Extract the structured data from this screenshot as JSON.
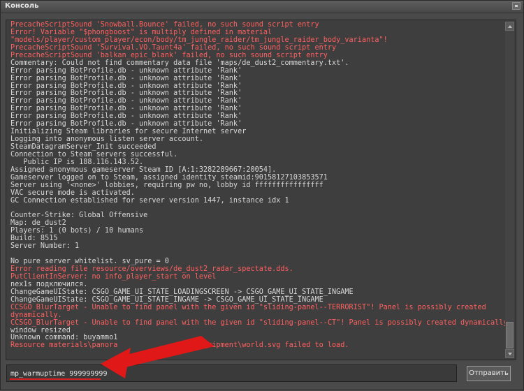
{
  "window": {
    "title": "Консоль"
  },
  "console": {
    "lines": [
      {
        "text": "PrecacheScriptSound 'Snowball.Bounce' failed, no such sound script entry",
        "type": "error"
      },
      {
        "text": "Error! Variable \"$phongboost\" is multiply defined in material",
        "type": "error"
      },
      {
        "text": "\"models/player/custom_player/econ/body/tm_jungle_raider/tm_jungle_raider_body_varianta\"!",
        "type": "error"
      },
      {
        "text": "PrecacheScriptSound 'Survival.VO.Taunt4a' failed, no such sound script entry",
        "type": "error"
      },
      {
        "text": "PrecacheScriptSound 'balkan_epic_blank' failed, no such sound script entry",
        "type": "error"
      },
      {
        "text": "Commentary: Could not find commentary data file 'maps/de_dust2_commentary.txt'.",
        "type": "normal"
      },
      {
        "text": "Error parsing BotProfile.db - unknown attribute 'Rank'",
        "type": "normal"
      },
      {
        "text": "Error parsing BotProfile.db - unknown attribute 'Rank'",
        "type": "normal"
      },
      {
        "text": "Error parsing BotProfile.db - unknown attribute 'Rank'",
        "type": "normal"
      },
      {
        "text": "Error parsing BotProfile.db - unknown attribute 'Rank'",
        "type": "normal"
      },
      {
        "text": "Error parsing BotProfile.db - unknown attribute 'Rank'",
        "type": "normal"
      },
      {
        "text": "Error parsing BotProfile.db - unknown attribute 'Rank'",
        "type": "normal"
      },
      {
        "text": "Error parsing BotProfile.db - unknown attribute 'Rank'",
        "type": "normal"
      },
      {
        "text": "Error parsing BotProfile.db - unknown attribute 'Rank'",
        "type": "normal"
      },
      {
        "text": "Initializing Steam libraries for secure Internet server",
        "type": "normal"
      },
      {
        "text": "Logging into anonymous listen server account.",
        "type": "normal"
      },
      {
        "text": "SteamDatagramServer_Init succeeded",
        "type": "normal"
      },
      {
        "text": "Connection to Steam servers successful.",
        "type": "normal"
      },
      {
        "text": "   Public IP is 188.116.143.52.",
        "type": "normal"
      },
      {
        "text": "Assigned anonymous gameserver Steam ID [A:1:3282289667:20054].",
        "type": "normal"
      },
      {
        "text": "Gameserver logged on to Steam, assigned identity steamid:90158127103853571",
        "type": "normal"
      },
      {
        "text": "Server using '<none>' lobbies, requiring pw no, lobby id ffffffffffffffff",
        "type": "normal"
      },
      {
        "text": "VAC secure mode is activated.",
        "type": "normal"
      },
      {
        "text": "GC Connection established for server version 1447, instance idx 1",
        "type": "normal"
      },
      {
        "text": "",
        "type": "normal"
      },
      {
        "text": "Counter-Strike: Global Offensive",
        "type": "normal"
      },
      {
        "text": "Map: de_dust2",
        "type": "normal"
      },
      {
        "text": "Players: 1 (0 bots) / 10 humans",
        "type": "normal"
      },
      {
        "text": "Build: 8515",
        "type": "normal"
      },
      {
        "text": "Server Number: 1",
        "type": "normal"
      },
      {
        "text": "",
        "type": "normal"
      },
      {
        "text": "No pure server whitelist. sv_pure = 0",
        "type": "normal"
      },
      {
        "text": "Error reading file resource/overviews/de_dust2_radar_spectate.dds.",
        "type": "error"
      },
      {
        "text": "PutClientInServer: no info_player_start on level",
        "type": "error"
      },
      {
        "text": "nex1s подключился.",
        "type": "normal"
      },
      {
        "text": "ChangeGameUIState: CSGO_GAME_UI_STATE_LOADINGSCREEN -> CSGO_GAME_UI_STATE_INGAME",
        "type": "normal"
      },
      {
        "text": "ChangeGameUIState: CSGO_GAME_UI_STATE_INGAME -> CSGO_GAME_UI_STATE_INGAME",
        "type": "normal"
      },
      {
        "text": "CCSGO_BlurTarget - Unable to find panel with the given id \"sliding-panel--TERRORIST\"! Panel is possibly created",
        "type": "error"
      },
      {
        "text": "dynamically.",
        "type": "error"
      },
      {
        "text": "CCSGO_BlurTarget - Unable to find panel with the given id \"sliding-panel--CT\"! Panel is possibly created dynamically.",
        "type": "error"
      },
      {
        "text": "window resized",
        "type": "normal"
      },
      {
        "text": "Unknown command: buyammo1",
        "type": "normal"
      },
      {
        "text": "Resource materials\\panora                 s\\equipment\\world.svg failed to load.",
        "type": "error"
      }
    ]
  },
  "command_input": {
    "value": "mp_warmuptime 999999999"
  },
  "submit_button": {
    "label": "Отправить"
  },
  "colors": {
    "error_text": "#ff6060",
    "normal_text": "#d8d8d8",
    "annotation_arrow": "#e01818"
  }
}
